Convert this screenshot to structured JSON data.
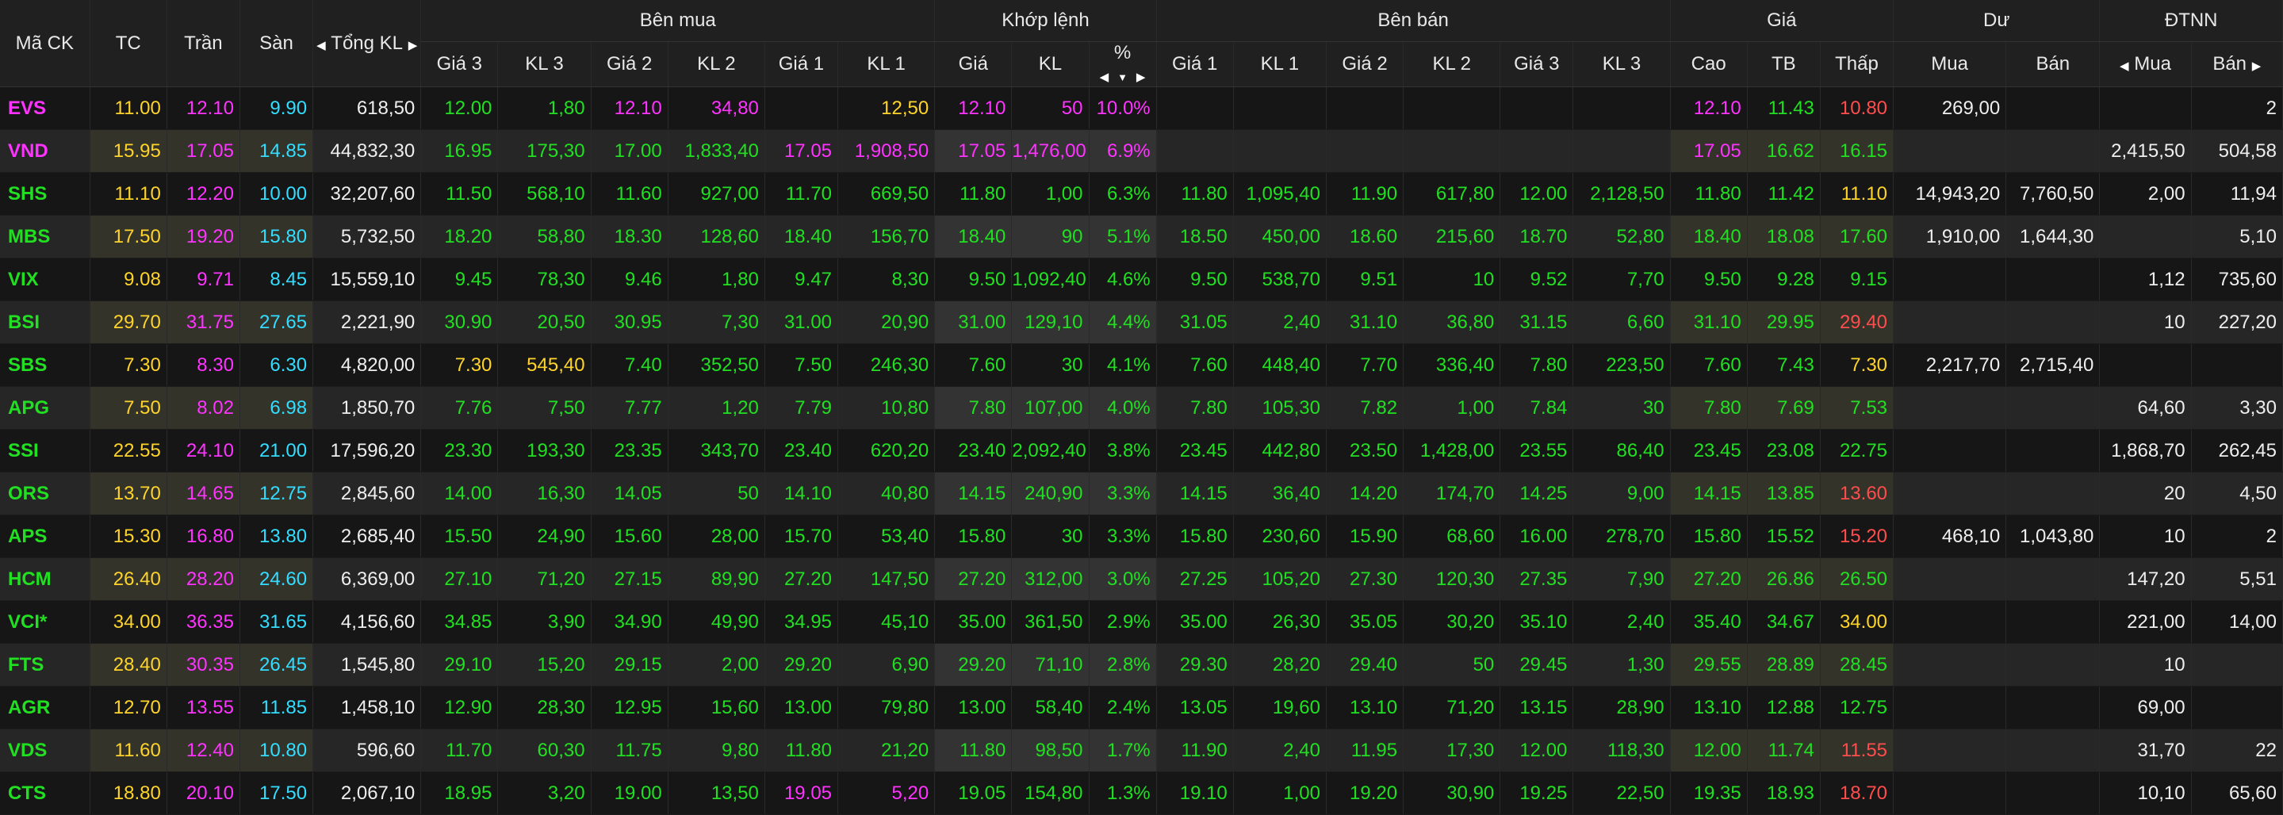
{
  "colors": {
    "up": "#21e021",
    "ref": "#ffd42a",
    "down": "#ff4d4d",
    "ceil": "#ff33ff",
    "floor": "#33ddff",
    "text": "#eeeeee"
  },
  "header": {
    "symbol": "Mã CK",
    "ref": "TC",
    "ceil": "Trần",
    "floor": "Sàn",
    "total": "Tổng KL",
    "bid_group": "Bên mua",
    "match_group": "Khớp lệnh",
    "ask_group": "Bên bán",
    "price_group": "Giá",
    "remain_group": "Dư",
    "foreign_group": "ĐTNN",
    "bid_p3": "Giá 3",
    "bid_v3": "KL 3",
    "bid_p2": "Giá 2",
    "bid_v2": "KL 2",
    "bid_p1": "Giá 1",
    "bid_v1": "KL 1",
    "match_price": "Giá",
    "match_vol": "KL",
    "match_pct": "%",
    "ask_p1": "Giá 1",
    "ask_v1": "KL 1",
    "ask_p2": "Giá 2",
    "ask_v2": "KL 2",
    "ask_p3": "Giá 3",
    "ask_v3": "KL 3",
    "high": "Cao",
    "avg": "TB",
    "low": "Thấp",
    "remain_buy": "Mua",
    "remain_sell": "Bán",
    "foreign_buy": "Mua",
    "foreign_sell": "Bán"
  },
  "rows": [
    {
      "symbol": "EVS",
      "tc": "11.00",
      "tran": "12.10",
      "san": "9.90",
      "total": "618,50",
      "bid": [
        [
          "12.00",
          "1,80",
          "u"
        ],
        [
          "12.10",
          "34,80",
          "c"
        ],
        [
          "",
          "12,50",
          "r"
        ]
      ],
      "match": [
        "12.10",
        "50",
        "10.0%",
        "c"
      ],
      "ask": [
        [
          "",
          "",
          ""
        ],
        [
          "",
          "",
          ""
        ],
        [
          "",
          "",
          ""
        ]
      ],
      "high": [
        "12.10",
        "c"
      ],
      "avg": [
        "11.43",
        "u"
      ],
      "low": [
        "10.80",
        "d"
      ],
      "rbuy": "269,00",
      "rsell": "",
      "fbuy": "",
      "fsell": "2"
    },
    {
      "symbol": "VND",
      "tc": "15.95",
      "tran": "17.05",
      "san": "14.85",
      "total": "44,832,30",
      "bid": [
        [
          "16.95",
          "175,30",
          "u"
        ],
        [
          "17.00",
          "1,833,40",
          "u"
        ],
        [
          "17.05",
          "1,908,50",
          "c"
        ]
      ],
      "match": [
        "17.05",
        "1,476,00",
        "6.9%",
        "c"
      ],
      "ask": [
        [
          "",
          "",
          ""
        ],
        [
          "",
          "",
          ""
        ],
        [
          "",
          "",
          ""
        ]
      ],
      "high": [
        "17.05",
        "c"
      ],
      "avg": [
        "16.62",
        "u"
      ],
      "low": [
        "16.15",
        "u"
      ],
      "rbuy": "",
      "rsell": "",
      "fbuy": "2,415,50",
      "fsell": "504,58"
    },
    {
      "symbol": "SHS",
      "tc": "11.10",
      "tran": "12.20",
      "san": "10.00",
      "total": "32,207,60",
      "bid": [
        [
          "11.50",
          "568,10",
          "u"
        ],
        [
          "11.60",
          "927,00",
          "u"
        ],
        [
          "11.70",
          "669,50",
          "u"
        ]
      ],
      "match": [
        "11.80",
        "1,00",
        "6.3%",
        "u"
      ],
      "ask": [
        [
          "11.80",
          "1,095,40",
          "u"
        ],
        [
          "11.90",
          "617,80",
          "u"
        ],
        [
          "12.00",
          "2,128,50",
          "u"
        ]
      ],
      "high": [
        "11.80",
        "u"
      ],
      "avg": [
        "11.42",
        "u"
      ],
      "low": [
        "11.10",
        "r"
      ],
      "rbuy": "14,943,20",
      "rsell": "7,760,50",
      "fbuy": "2,00",
      "fsell": "11,94"
    },
    {
      "symbol": "MBS",
      "tc": "17.50",
      "tran": "19.20",
      "san": "15.80",
      "total": "5,732,50",
      "bid": [
        [
          "18.20",
          "58,80",
          "u"
        ],
        [
          "18.30",
          "128,60",
          "u"
        ],
        [
          "18.40",
          "156,70",
          "u"
        ]
      ],
      "match": [
        "18.40",
        "90",
        "5.1%",
        "u"
      ],
      "ask": [
        [
          "18.50",
          "450,00",
          "u"
        ],
        [
          "18.60",
          "215,60",
          "u"
        ],
        [
          "18.70",
          "52,80",
          "u"
        ]
      ],
      "high": [
        "18.40",
        "u"
      ],
      "avg": [
        "18.08",
        "u"
      ],
      "low": [
        "17.60",
        "u"
      ],
      "rbuy": "1,910,00",
      "rsell": "1,644,30",
      "fbuy": "",
      "fsell": "5,10"
    },
    {
      "symbol": "VIX",
      "tc": "9.08",
      "tran": "9.71",
      "san": "8.45",
      "total": "15,559,10",
      "bid": [
        [
          "9.45",
          "78,30",
          "u"
        ],
        [
          "9.46",
          "1,80",
          "u"
        ],
        [
          "9.47",
          "8,30",
          "u"
        ]
      ],
      "match": [
        "9.50",
        "1,092,40",
        "4.6%",
        "u"
      ],
      "ask": [
        [
          "9.50",
          "538,70",
          "u"
        ],
        [
          "9.51",
          "10",
          "u"
        ],
        [
          "9.52",
          "7,70",
          "u"
        ]
      ],
      "high": [
        "9.50",
        "u"
      ],
      "avg": [
        "9.28",
        "u"
      ],
      "low": [
        "9.15",
        "u"
      ],
      "rbuy": "",
      "rsell": "",
      "fbuy": "1,12",
      "fsell": "735,60"
    },
    {
      "symbol": "BSI",
      "tc": "29.70",
      "tran": "31.75",
      "san": "27.65",
      "total": "2,221,90",
      "bid": [
        [
          "30.90",
          "20,50",
          "u"
        ],
        [
          "30.95",
          "7,30",
          "u"
        ],
        [
          "31.00",
          "20,90",
          "u"
        ]
      ],
      "match": [
        "31.00",
        "129,10",
        "4.4%",
        "u"
      ],
      "ask": [
        [
          "31.05",
          "2,40",
          "u"
        ],
        [
          "31.10",
          "36,80",
          "u"
        ],
        [
          "31.15",
          "6,60",
          "u"
        ]
      ],
      "high": [
        "31.10",
        "u"
      ],
      "avg": [
        "29.95",
        "u"
      ],
      "low": [
        "29.40",
        "d"
      ],
      "rbuy": "",
      "rsell": "",
      "fbuy": "10",
      "fsell": "227,20"
    },
    {
      "symbol": "SBS",
      "tc": "7.30",
      "tran": "8.30",
      "san": "6.30",
      "total": "4,820,00",
      "bid": [
        [
          "7.30",
          "545,40",
          "r"
        ],
        [
          "7.40",
          "352,50",
          "u"
        ],
        [
          "7.50",
          "246,30",
          "u"
        ]
      ],
      "match": [
        "7.60",
        "30",
        "4.1%",
        "u"
      ],
      "ask": [
        [
          "7.60",
          "448,40",
          "u"
        ],
        [
          "7.70",
          "336,40",
          "u"
        ],
        [
          "7.80",
          "223,50",
          "u"
        ]
      ],
      "high": [
        "7.60",
        "u"
      ],
      "avg": [
        "7.43",
        "u"
      ],
      "low": [
        "7.30",
        "r"
      ],
      "rbuy": "2,217,70",
      "rsell": "2,715,40",
      "fbuy": "",
      "fsell": ""
    },
    {
      "symbol": "APG",
      "tc": "7.50",
      "tran": "8.02",
      "san": "6.98",
      "total": "1,850,70",
      "bid": [
        [
          "7.76",
          "7,50",
          "u"
        ],
        [
          "7.77",
          "1,20",
          "u"
        ],
        [
          "7.79",
          "10,80",
          "u"
        ]
      ],
      "match": [
        "7.80",
        "107,00",
        "4.0%",
        "u"
      ],
      "ask": [
        [
          "7.80",
          "105,30",
          "u"
        ],
        [
          "7.82",
          "1,00",
          "u"
        ],
        [
          "7.84",
          "30",
          "u"
        ]
      ],
      "high": [
        "7.80",
        "u"
      ],
      "avg": [
        "7.69",
        "u"
      ],
      "low": [
        "7.53",
        "u"
      ],
      "rbuy": "",
      "rsell": "",
      "fbuy": "64,60",
      "fsell": "3,30"
    },
    {
      "symbol": "SSI",
      "tc": "22.55",
      "tran": "24.10",
      "san": "21.00",
      "total": "17,596,20",
      "bid": [
        [
          "23.30",
          "193,30",
          "u"
        ],
        [
          "23.35",
          "343,70",
          "u"
        ],
        [
          "23.40",
          "620,20",
          "u"
        ]
      ],
      "match": [
        "23.40",
        "2,092,40",
        "3.8%",
        "u"
      ],
      "ask": [
        [
          "23.45",
          "442,80",
          "u"
        ],
        [
          "23.50",
          "1,428,00",
          "u"
        ],
        [
          "23.55",
          "86,40",
          "u"
        ]
      ],
      "high": [
        "23.45",
        "u"
      ],
      "avg": [
        "23.08",
        "u"
      ],
      "low": [
        "22.75",
        "u"
      ],
      "rbuy": "",
      "rsell": "",
      "fbuy": "1,868,70",
      "fsell": "262,45"
    },
    {
      "symbol": "ORS",
      "tc": "13.70",
      "tran": "14.65",
      "san": "12.75",
      "total": "2,845,60",
      "bid": [
        [
          "14.00",
          "16,30",
          "u"
        ],
        [
          "14.05",
          "50",
          "u"
        ],
        [
          "14.10",
          "40,80",
          "u"
        ]
      ],
      "match": [
        "14.15",
        "240,90",
        "3.3%",
        "u"
      ],
      "ask": [
        [
          "14.15",
          "36,40",
          "u"
        ],
        [
          "14.20",
          "174,70",
          "u"
        ],
        [
          "14.25",
          "9,00",
          "u"
        ]
      ],
      "high": [
        "14.15",
        "u"
      ],
      "avg": [
        "13.85",
        "u"
      ],
      "low": [
        "13.60",
        "d"
      ],
      "rbuy": "",
      "rsell": "",
      "fbuy": "20",
      "fsell": "4,50"
    },
    {
      "symbol": "APS",
      "tc": "15.30",
      "tran": "16.80",
      "san": "13.80",
      "total": "2,685,40",
      "bid": [
        [
          "15.50",
          "24,90",
          "u"
        ],
        [
          "15.60",
          "28,00",
          "u"
        ],
        [
          "15.70",
          "53,40",
          "u"
        ]
      ],
      "match": [
        "15.80",
        "30",
        "3.3%",
        "u"
      ],
      "ask": [
        [
          "15.80",
          "230,60",
          "u"
        ],
        [
          "15.90",
          "68,60",
          "u"
        ],
        [
          "16.00",
          "278,70",
          "u"
        ]
      ],
      "high": [
        "15.80",
        "u"
      ],
      "avg": [
        "15.52",
        "u"
      ],
      "low": [
        "15.20",
        "d"
      ],
      "rbuy": "468,10",
      "rsell": "1,043,80",
      "fbuy": "10",
      "fsell": "2"
    },
    {
      "symbol": "HCM",
      "tc": "26.40",
      "tran": "28.20",
      "san": "24.60",
      "total": "6,369,00",
      "bid": [
        [
          "27.10",
          "71,20",
          "u"
        ],
        [
          "27.15",
          "89,90",
          "u"
        ],
        [
          "27.20",
          "147,50",
          "u"
        ]
      ],
      "match": [
        "27.20",
        "312,00",
        "3.0%",
        "u"
      ],
      "ask": [
        [
          "27.25",
          "105,20",
          "u"
        ],
        [
          "27.30",
          "120,30",
          "u"
        ],
        [
          "27.35",
          "7,90",
          "u"
        ]
      ],
      "high": [
        "27.20",
        "u"
      ],
      "avg": [
        "26.86",
        "u"
      ],
      "low": [
        "26.50",
        "u"
      ],
      "rbuy": "",
      "rsell": "",
      "fbuy": "147,20",
      "fsell": "5,51"
    },
    {
      "symbol": "VCI*",
      "tc": "34.00",
      "tran": "36.35",
      "san": "31.65",
      "total": "4,156,60",
      "bid": [
        [
          "34.85",
          "3,90",
          "u"
        ],
        [
          "34.90",
          "49,90",
          "u"
        ],
        [
          "34.95",
          "45,10",
          "u"
        ]
      ],
      "match": [
        "35.00",
        "361,50",
        "2.9%",
        "u"
      ],
      "ask": [
        [
          "35.00",
          "26,30",
          "u"
        ],
        [
          "35.05",
          "30,20",
          "u"
        ],
        [
          "35.10",
          "2,40",
          "u"
        ]
      ],
      "high": [
        "35.40",
        "u"
      ],
      "avg": [
        "34.67",
        "u"
      ],
      "low": [
        "34.00",
        "r"
      ],
      "rbuy": "",
      "rsell": "",
      "fbuy": "221,00",
      "fsell": "14,00"
    },
    {
      "symbol": "FTS",
      "tc": "28.40",
      "tran": "30.35",
      "san": "26.45",
      "total": "1,545,80",
      "bid": [
        [
          "29.10",
          "15,20",
          "u"
        ],
        [
          "29.15",
          "2,00",
          "u"
        ],
        [
          "29.20",
          "6,90",
          "u"
        ]
      ],
      "match": [
        "29.20",
        "71,10",
        "2.8%",
        "u"
      ],
      "ask": [
        [
          "29.30",
          "28,20",
          "u"
        ],
        [
          "29.40",
          "50",
          "u"
        ],
        [
          "29.45",
          "1,30",
          "u"
        ]
      ],
      "high": [
        "29.55",
        "u"
      ],
      "avg": [
        "28.89",
        "u"
      ],
      "low": [
        "28.45",
        "u"
      ],
      "rbuy": "",
      "rsell": "",
      "fbuy": "10",
      "fsell": ""
    },
    {
      "symbol": "AGR",
      "tc": "12.70",
      "tran": "13.55",
      "san": "11.85",
      "total": "1,458,10",
      "bid": [
        [
          "12.90",
          "28,30",
          "u"
        ],
        [
          "12.95",
          "15,60",
          "u"
        ],
        [
          "13.00",
          "79,80",
          "u"
        ]
      ],
      "match": [
        "13.00",
        "58,40",
        "2.4%",
        "u"
      ],
      "ask": [
        [
          "13.05",
          "19,60",
          "u"
        ],
        [
          "13.10",
          "71,20",
          "u"
        ],
        [
          "13.15",
          "28,90",
          "u"
        ]
      ],
      "high": [
        "13.10",
        "u"
      ],
      "avg": [
        "12.88",
        "u"
      ],
      "low": [
        "12.75",
        "u"
      ],
      "rbuy": "",
      "rsell": "",
      "fbuy": "69,00",
      "fsell": ""
    },
    {
      "symbol": "VDS",
      "tc": "11.60",
      "tran": "12.40",
      "san": "10.80",
      "total": "596,60",
      "bid": [
        [
          "11.70",
          "60,30",
          "u"
        ],
        [
          "11.75",
          "9,80",
          "u"
        ],
        [
          "11.80",
          "21,20",
          "u"
        ]
      ],
      "match": [
        "11.80",
        "98,50",
        "1.7%",
        "u"
      ],
      "ask": [
        [
          "11.90",
          "2,40",
          "u"
        ],
        [
          "11.95",
          "17,30",
          "u"
        ],
        [
          "12.00",
          "118,30",
          "u"
        ]
      ],
      "high": [
        "12.00",
        "u"
      ],
      "avg": [
        "11.74",
        "u"
      ],
      "low": [
        "11.55",
        "d"
      ],
      "rbuy": "",
      "rsell": "",
      "fbuy": "31,70",
      "fsell": "22"
    },
    {
      "symbol": "CTS",
      "tc": "18.80",
      "tran": "20.10",
      "san": "17.50",
      "total": "2,067,10",
      "bid": [
        [
          "18.95",
          "3,20",
          "u"
        ],
        [
          "19.00",
          "13,50",
          "u"
        ],
        [
          "19.05",
          "5,20",
          "c"
        ]
      ],
      "match": [
        "19.05",
        "154,80",
        "1.3%",
        "u"
      ],
      "ask": [
        [
          "19.10",
          "1,00",
          "u"
        ],
        [
          "19.20",
          "30,90",
          "u"
        ],
        [
          "19.25",
          "22,50",
          "u"
        ]
      ],
      "high": [
        "19.35",
        "u"
      ],
      "avg": [
        "18.93",
        "u"
      ],
      "low": [
        "18.70",
        "d"
      ],
      "rbuy": "",
      "rsell": "",
      "fbuy": "10,10",
      "fsell": "65,60"
    }
  ]
}
